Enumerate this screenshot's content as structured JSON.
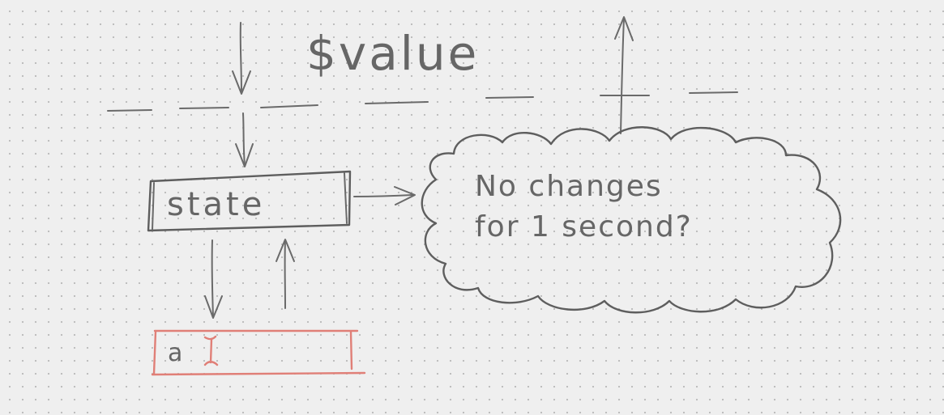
{
  "variable_label": "$value",
  "state_label": "state",
  "input_value": "a",
  "cloud_text": {
    "line1": "No changes",
    "line2": "for 1 second?"
  },
  "colors": {
    "paper": "#efefef",
    "pencil": "#5e5e5e",
    "input_outline": "#e07f77"
  }
}
